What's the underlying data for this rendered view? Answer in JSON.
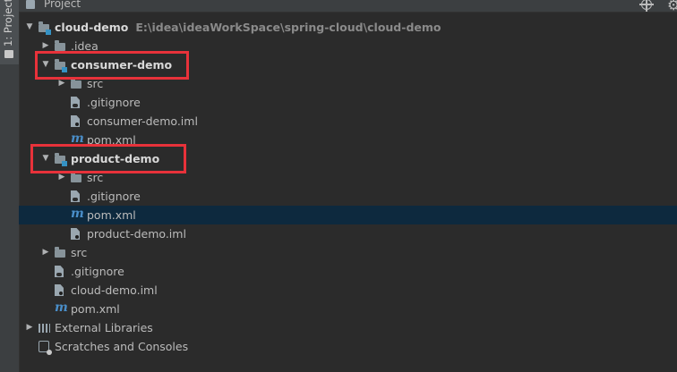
{
  "side_tab": {
    "label": "1: Project"
  },
  "header": {
    "title": "Project"
  },
  "tree": [
    {
      "depth": 0,
      "arrow": "▼",
      "icon": "module-folder-icon",
      "label": "cloud-demo",
      "bold": true,
      "path": "E:\\idea\\ideaWorkSpace\\spring-cloud\\cloud-demo"
    },
    {
      "depth": 1,
      "arrow": "▶",
      "icon": "folder-icon",
      "label": ".idea"
    },
    {
      "depth": 1,
      "arrow": "▼",
      "icon": "module-folder-icon",
      "label": "consumer-demo",
      "bold": true
    },
    {
      "depth": 2,
      "arrow": "▶",
      "icon": "folder-icon",
      "label": "src"
    },
    {
      "depth": 2,
      "icon": "gitignore-file-icon",
      "label": ".gitignore"
    },
    {
      "depth": 2,
      "icon": "iml-file-icon",
      "label": "consumer-demo.iml"
    },
    {
      "depth": 2,
      "icon": "maven-icon",
      "label": "pom.xml"
    },
    {
      "depth": 1,
      "arrow": "▼",
      "icon": "module-folder-icon",
      "label": "product-demo",
      "bold": true
    },
    {
      "depth": 2,
      "arrow": "▶",
      "icon": "folder-icon",
      "label": "src"
    },
    {
      "depth": 2,
      "icon": "gitignore-file-icon",
      "label": ".gitignore"
    },
    {
      "depth": 2,
      "icon": "maven-icon",
      "label": "pom.xml",
      "selected": true
    },
    {
      "depth": 2,
      "icon": "iml-file-icon",
      "label": "product-demo.iml"
    },
    {
      "depth": 1,
      "arrow": "▶",
      "icon": "folder-icon",
      "label": "src"
    },
    {
      "depth": 1,
      "icon": "gitignore-file-icon",
      "label": ".gitignore"
    },
    {
      "depth": 1,
      "icon": "iml-file-icon",
      "label": "cloud-demo.iml"
    },
    {
      "depth": 1,
      "icon": "maven-icon",
      "label": "pom.xml"
    },
    {
      "depth": 0,
      "arrow": "▶",
      "icon": "libraries-icon",
      "label": "External Libraries"
    },
    {
      "depth": 0,
      "icon": "scratches-icon",
      "label": "Scratches and Consoles"
    }
  ],
  "colors": {
    "highlight_box": "#e8323a",
    "selection": "#0d293e",
    "background": "#2b2b2b"
  }
}
